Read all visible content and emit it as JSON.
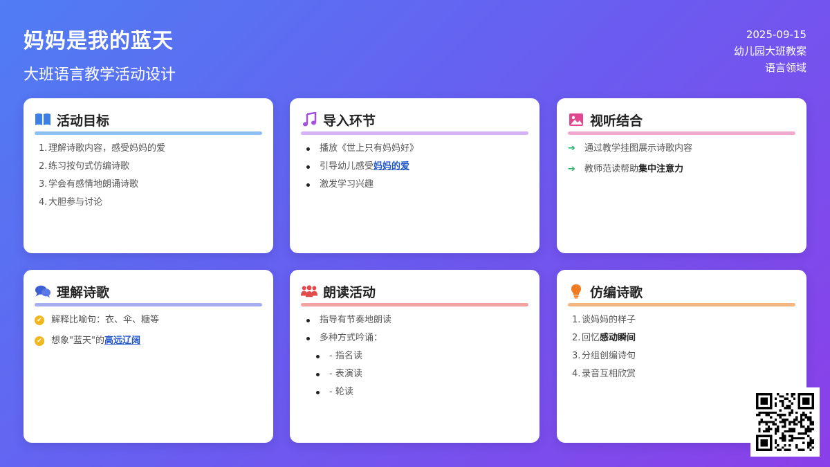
{
  "header": {
    "title": "妈妈是我的蓝天",
    "subtitle": "大班语言教学活动设计",
    "date": "2025-09-15",
    "doc_type": "幼儿园大班教案",
    "domain": "语言领域"
  },
  "cards": [
    {
      "title": "活动目标",
      "icon": "book-icon",
      "bar_color": "#8ec0f3",
      "items": [
        "1.",
        "理解诗歌内容，感受妈妈的爱",
        "2.",
        "练习按句式仿编诗歌",
        "3.",
        "学会有感情地朗诵诗歌",
        "4.",
        "大胆参与讨论"
      ]
    },
    {
      "title": "导入环节",
      "icon": "music-icon",
      "bar_color": "#d5b2f5",
      "items": {
        "i1": "播放《世上只有妈妈好》",
        "i2_pre": "引导幼儿感受",
        "i2_link": "妈妈的爱",
        "i3": "激发学习兴趣"
      }
    },
    {
      "title": "视听结合",
      "icon": "image-icon",
      "bar_color": "#f3a9cf",
      "items": {
        "i1": "通过教学挂图展示诗歌内容",
        "i2_pre": "教师范读帮助",
        "i2_strong": "集中注意力"
      }
    },
    {
      "title": "理解诗歌",
      "icon": "chat-icon",
      "bar_color": "#a6aef0",
      "items": {
        "i1": "解释比喻句：衣、伞、糖等",
        "i2_pre": "想象\"蓝天\"的",
        "i2_link": "高远辽阔"
      }
    },
    {
      "title": "朗读活动",
      "icon": "users-icon",
      "bar_color": "#f2a4a4",
      "items": {
        "i1": "指导有节奏地朗读",
        "i2": "多种方式吟诵：",
        "s1": "- 指名读",
        "s2": "- 表演读",
        "s3": "- 轮读"
      }
    },
    {
      "title": "仿编诗歌",
      "icon": "lightbulb-icon",
      "bar_color": "#f5b782",
      "items": {
        "n1": "1.",
        "i1": "谈妈妈的样子",
        "n2": "2.",
        "i2_pre": "回忆",
        "i2_strong": "感动瞬间",
        "n3": "3.",
        "i3": "分组创编诗句",
        "n4": "4.",
        "i4": "录音互相欣赏"
      }
    }
  ]
}
